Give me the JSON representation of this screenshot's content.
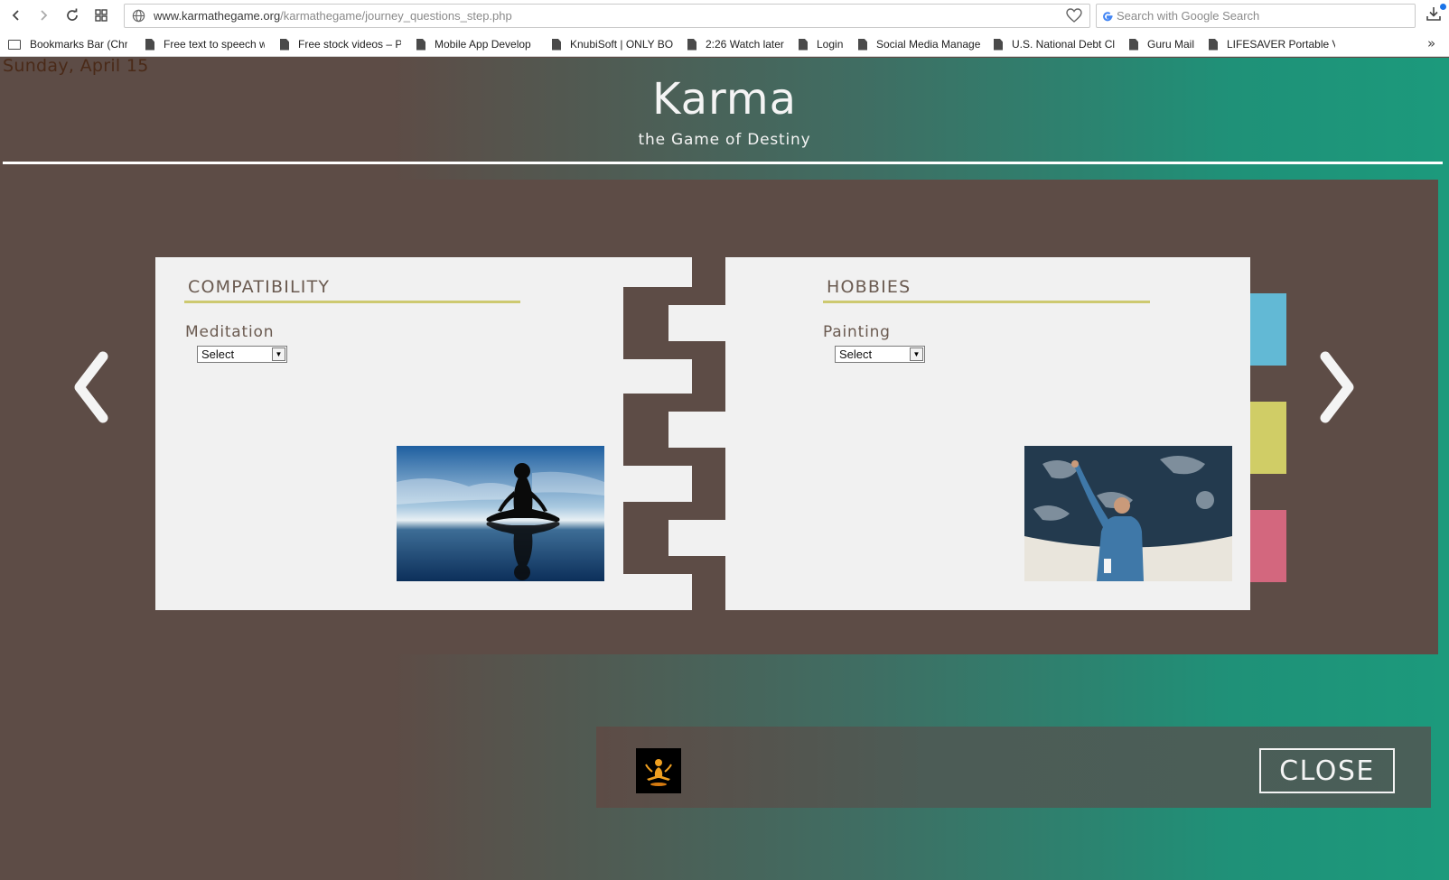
{
  "browser": {
    "url_domain": "www.karmathegame.org",
    "url_path": "/karmathegame/journey_questions_step.php",
    "search_placeholder": "Search with Google Search",
    "bookmarks": [
      "Bookmarks Bar (Chro",
      "Free text to speech w",
      "Free stock videos – P",
      "Mobile App Develop",
      "KnubiSoft | ONLY BO",
      "2:26 Watch later",
      "Login",
      "Social Media Manage",
      "U.S. National Debt Cl",
      "Guru Mail",
      "LIFESAVER Portable V"
    ],
    "more_label": "»"
  },
  "page": {
    "date": "Sunday, April 15",
    "title": "Karma",
    "subtitle": "the Game of Destiny"
  },
  "left_card": {
    "section": "COMPATIBILITY",
    "question": "Meditation",
    "select_value": "Select",
    "image": "meditation silhouette on beach"
  },
  "right_card": {
    "section": "HOBBIES",
    "question": "Painting",
    "select_value": "Select",
    "image": "man painting ceiling mural"
  },
  "tabs": {
    "colors": [
      "#62b9d5",
      "#d0cd66",
      "#d3677e"
    ]
  },
  "footer": {
    "close_label": "CLOSE"
  },
  "colors": {
    "brown": "#5d4c46",
    "teal": "#1c9a7c",
    "accent_line": "#cdc970"
  }
}
